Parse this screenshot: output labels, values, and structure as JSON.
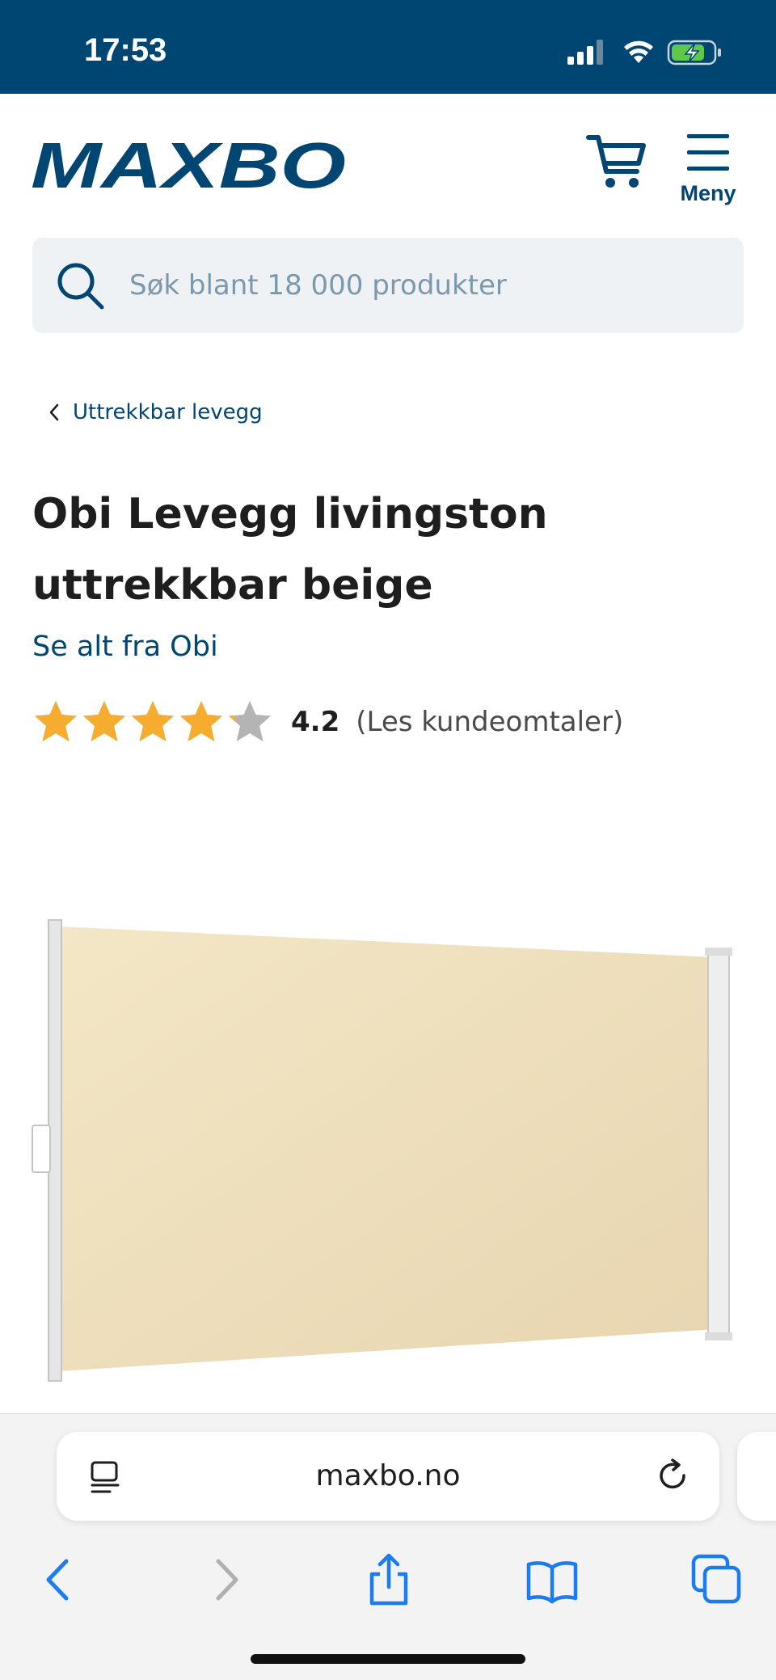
{
  "status_bar": {
    "time": "17:53"
  },
  "header": {
    "logo_text": "MAXBO",
    "menu_label": "Meny",
    "brand_color": "#004672"
  },
  "search": {
    "placeholder": "Søk blant 18 000 produkter",
    "value": ""
  },
  "breadcrumb": {
    "label": "Uttrekkbar levegg"
  },
  "product": {
    "title_line1": "Obi Levegg livingston",
    "title_line2": "uttrekkbar beige",
    "brand_link": "Se alt fra Obi",
    "rating_value": "4.2",
    "rating_fraction": 0.84,
    "star_count": 5,
    "review_link": "(Les  kundeomtaler)",
    "image_icon": "retractable-screen-image"
  },
  "browser": {
    "url": "maxbo.no",
    "toolbar_icons": [
      "back-icon",
      "forward-icon",
      "share-icon",
      "bookmarks-icon",
      "tabs-icon"
    ],
    "accent_color": "#1a7cf0"
  },
  "colors": {
    "star_fill": "#f6ac2e",
    "star_empty": "#b4b4b4",
    "status_bar_bg": "#004672"
  }
}
